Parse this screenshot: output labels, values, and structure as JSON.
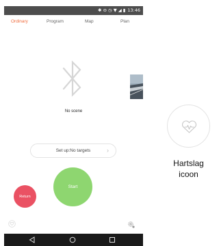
{
  "status_bar": {
    "time": "13:46",
    "icons": [
      "bluetooth-icon",
      "dnd-icon",
      "alarm-icon",
      "wifi-icon",
      "signal-icon",
      "battery-icon"
    ]
  },
  "tabs": [
    {
      "label": "Ordinary",
      "active": true
    },
    {
      "label": "Program",
      "active": false
    },
    {
      "label": "Map",
      "active": false
    },
    {
      "label": "Plan",
      "active": false
    }
  ],
  "scene": {
    "label": "No scene",
    "icon": "bluetooth-icon"
  },
  "setup": {
    "label": "Set up:No targets",
    "icon": "chevron-right-icon"
  },
  "buttons": {
    "return_label": "Return",
    "start_label": "Start"
  },
  "annotation": {
    "icon": "heartbeat-icon",
    "caption_line1": "Hartslag",
    "caption_line2": "icoon"
  },
  "colors": {
    "accent": "#f06b3c",
    "return": "#ea5163",
    "start": "#8ed670",
    "status_bar": "#4d4d4d",
    "nav_bar": "#1a1a1a"
  }
}
